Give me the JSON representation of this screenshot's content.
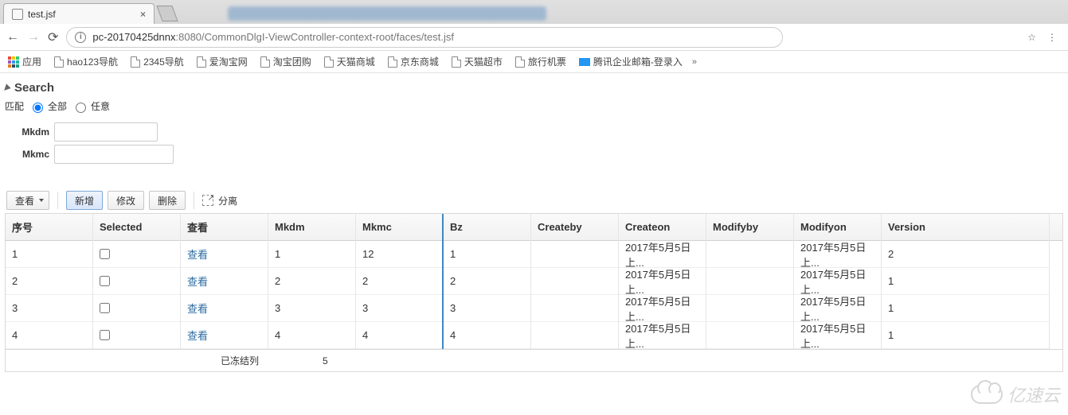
{
  "browser": {
    "tab_title": "test.jsf",
    "url_host": "pc-20170425dnnx",
    "url_port": ":8080",
    "url_path": "/CommonDlgI-ViewController-context-root/faces/test.jsf"
  },
  "bookmarks": {
    "apps": "应用",
    "items": [
      "hao123导航",
      "2345导航",
      "爱淘宝网",
      "淘宝团购",
      "天猫商城",
      "京东商城",
      "天猫超市",
      "旅行机票"
    ],
    "mail": "腾讯企业邮箱-登录入",
    "overflow": ""
  },
  "search": {
    "title": "Search",
    "match_label": "匹配",
    "opt_all": "全部",
    "opt_any": "任意",
    "field1_label": "Mkdm",
    "field1_value": "",
    "field2_label": "Mkmc",
    "field2_value": ""
  },
  "toolbar": {
    "view": "查看",
    "add": "新增",
    "edit": "修改",
    "delete": "删除",
    "detach": "分离"
  },
  "table": {
    "headers": {
      "seq": "序号",
      "selected": "Selected",
      "view": "查看",
      "mkdm": "Mkdm",
      "mkmc": "Mkmc",
      "bz": "Bz",
      "createby": "Createby",
      "createon": "Createon",
      "modifyby": "Modifyby",
      "modifyon": "Modifyon",
      "version": "Version"
    },
    "rows": [
      {
        "seq": "1",
        "view": "查看",
        "mkdm": "1",
        "mkmc": "12",
        "bz": "1",
        "createby": "",
        "createon": "2017年5月5日 上...",
        "modifyby": "",
        "modifyon": "2017年5月5日 上...",
        "version": "2"
      },
      {
        "seq": "2",
        "view": "查看",
        "mkdm": "2",
        "mkmc": "2",
        "bz": "2",
        "createby": "",
        "createon": "2017年5月5日 上...",
        "modifyby": "",
        "modifyon": "2017年5月5日 上...",
        "version": "1"
      },
      {
        "seq": "3",
        "view": "查看",
        "mkdm": "3",
        "mkmc": "3",
        "bz": "3",
        "createby": "",
        "createon": "2017年5月5日 上...",
        "modifyby": "",
        "modifyon": "2017年5月5日 上...",
        "version": "1"
      },
      {
        "seq": "4",
        "view": "查看",
        "mkdm": "4",
        "mkmc": "4",
        "bz": "4",
        "createby": "",
        "createon": "2017年5月5日 上...",
        "modifyby": "",
        "modifyon": "2017年5月5日 上...",
        "version": "1"
      }
    ],
    "footer_label": "已冻结列",
    "footer_value": "5"
  },
  "watermark": "亿速云"
}
